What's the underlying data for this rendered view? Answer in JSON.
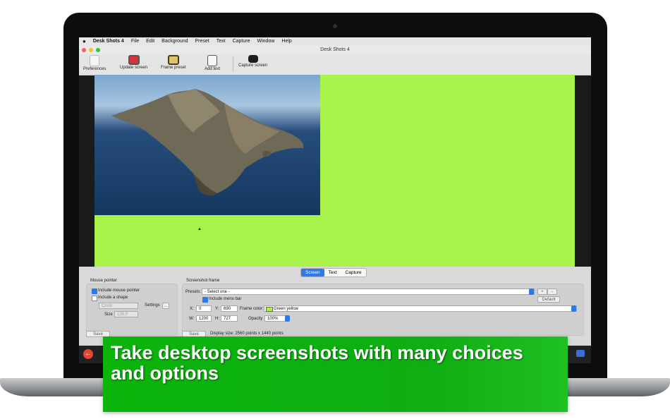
{
  "menubar": {
    "apple_icon": "apple-icon",
    "app_name": "Desk Shots 4",
    "items": [
      "File",
      "Edit",
      "Background",
      "Preset",
      "Text",
      "Capture",
      "Window",
      "Help"
    ]
  },
  "window": {
    "title": "Desk Shots 4"
  },
  "toolbar": {
    "items": [
      {
        "label": "Preferences",
        "icon": "preferences-icon"
      },
      {
        "label": "Update screen",
        "icon": "update-screen-icon"
      },
      {
        "label": "Frame preset",
        "icon": "frame-preset-icon"
      },
      {
        "label": "Add text",
        "icon": "add-text-icon"
      },
      {
        "label": "Capture screen",
        "icon": "camera-icon"
      }
    ]
  },
  "canvas": {
    "background_color": "#a8f24a"
  },
  "tabs": [
    "Screen",
    "Text",
    "Capture"
  ],
  "mouse_pointer": {
    "title": "Mouse pointer",
    "include_pointer": "Include mouse pointer",
    "include_pointer_checked": true,
    "include_shape": "Include a shape",
    "include_shape_checked": false,
    "shape_value": "Circle",
    "settings_label": "Settings",
    "size_label": "Size",
    "size_value": "128.0",
    "save": "Save"
  },
  "screenshot_frame": {
    "title": "Screenshot frame",
    "presets_label": "Presets:",
    "presets_value": "- Select one -",
    "plus": "+",
    "minus": "-",
    "include_menu_bar": "Include menu bar",
    "include_menu_bar_checked": true,
    "default_button": "Default",
    "x_label": "X:",
    "x_value": "0",
    "y_label": "Y:",
    "y_value": "690",
    "frame_color_label": "Frame color:",
    "frame_color_value": "Green yellow",
    "frame_color_hex": "#a8f24a",
    "w_label": "W:",
    "w_value": "1200",
    "h_label": "H:",
    "h_value": "727",
    "opacity_label": "Opacity",
    "opacity_value": "100%",
    "save": "Save",
    "display_size": "Display size: 2560 points x 1440 points"
  },
  "banner": {
    "text": "Take desktop screenshots with many choices and options",
    "color": "#0bb40b"
  }
}
